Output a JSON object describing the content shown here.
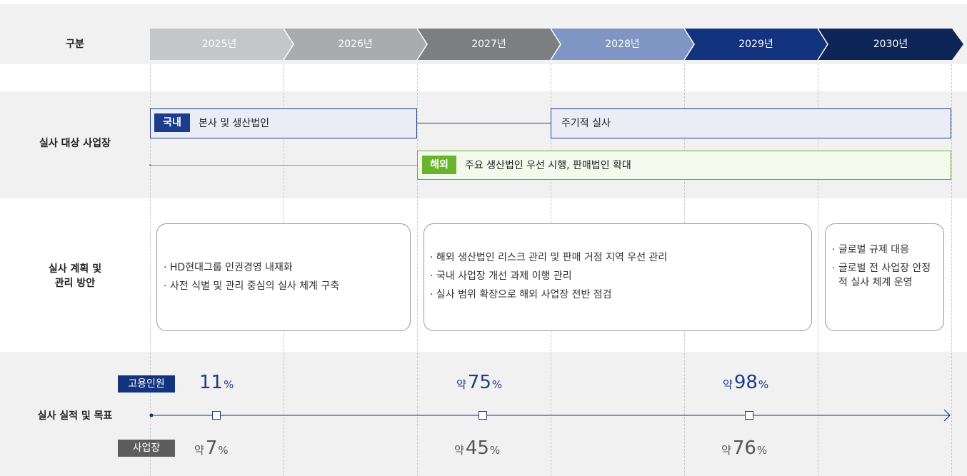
{
  "header": {
    "category_label": "구분",
    "years": [
      "2025년",
      "2026년",
      "2027년",
      "2028년",
      "2029년",
      "2030년"
    ],
    "year_colors": [
      "#c4c6c8",
      "#a9abad",
      "#7c7e80",
      "#7f95c4",
      "#13337f",
      "#0e2558"
    ]
  },
  "target_sites": {
    "label": "실사 대상 사업장",
    "domestic": {
      "tag": "국내",
      "text": "본사 및 생산법인",
      "later_text": "주기적 실사",
      "color": "#1c3d8c"
    },
    "overseas": {
      "tag": "해외",
      "text": "주요 생산법인 우선 시행, 판매법인 확대",
      "color": "#6ab42d"
    }
  },
  "plan": {
    "label_line1": "실사 계획 및",
    "label_line2": "관리 방안",
    "card1": [
      "· HD현대그룹 인권경영 내재화",
      "· 사전 식별 및 관리 중심의 실사 체계 구축"
    ],
    "card2": [
      "· 해외 생산법인 리스크 관리 및 판매 거점 지역 우선 관리",
      "· 국내 사업장 개선 과제 이행 관리",
      "· 실사 범위 확장으로 해외 사업장 전반 점검"
    ],
    "card3_item1": "· 글로벌 규제 대응",
    "card3_item2": "· 글로벌 전 사업장 안정적 실사 체계 운영"
  },
  "performance": {
    "label": "실사 실적 및 목표",
    "employees": {
      "tag": "고용인원",
      "values": [
        {
          "prefix": "",
          "value": "11",
          "unit": "%"
        },
        {
          "prefix": "약",
          "value": "75",
          "unit": "%"
        },
        {
          "prefix": "약",
          "value": "98",
          "unit": "%"
        }
      ]
    },
    "sites": {
      "tag": "사업장",
      "values": [
        {
          "prefix": "약",
          "value": "7",
          "unit": "%"
        },
        {
          "prefix": "약",
          "value": "45",
          "unit": "%"
        },
        {
          "prefix": "약",
          "value": "76",
          "unit": "%"
        }
      ]
    }
  }
}
